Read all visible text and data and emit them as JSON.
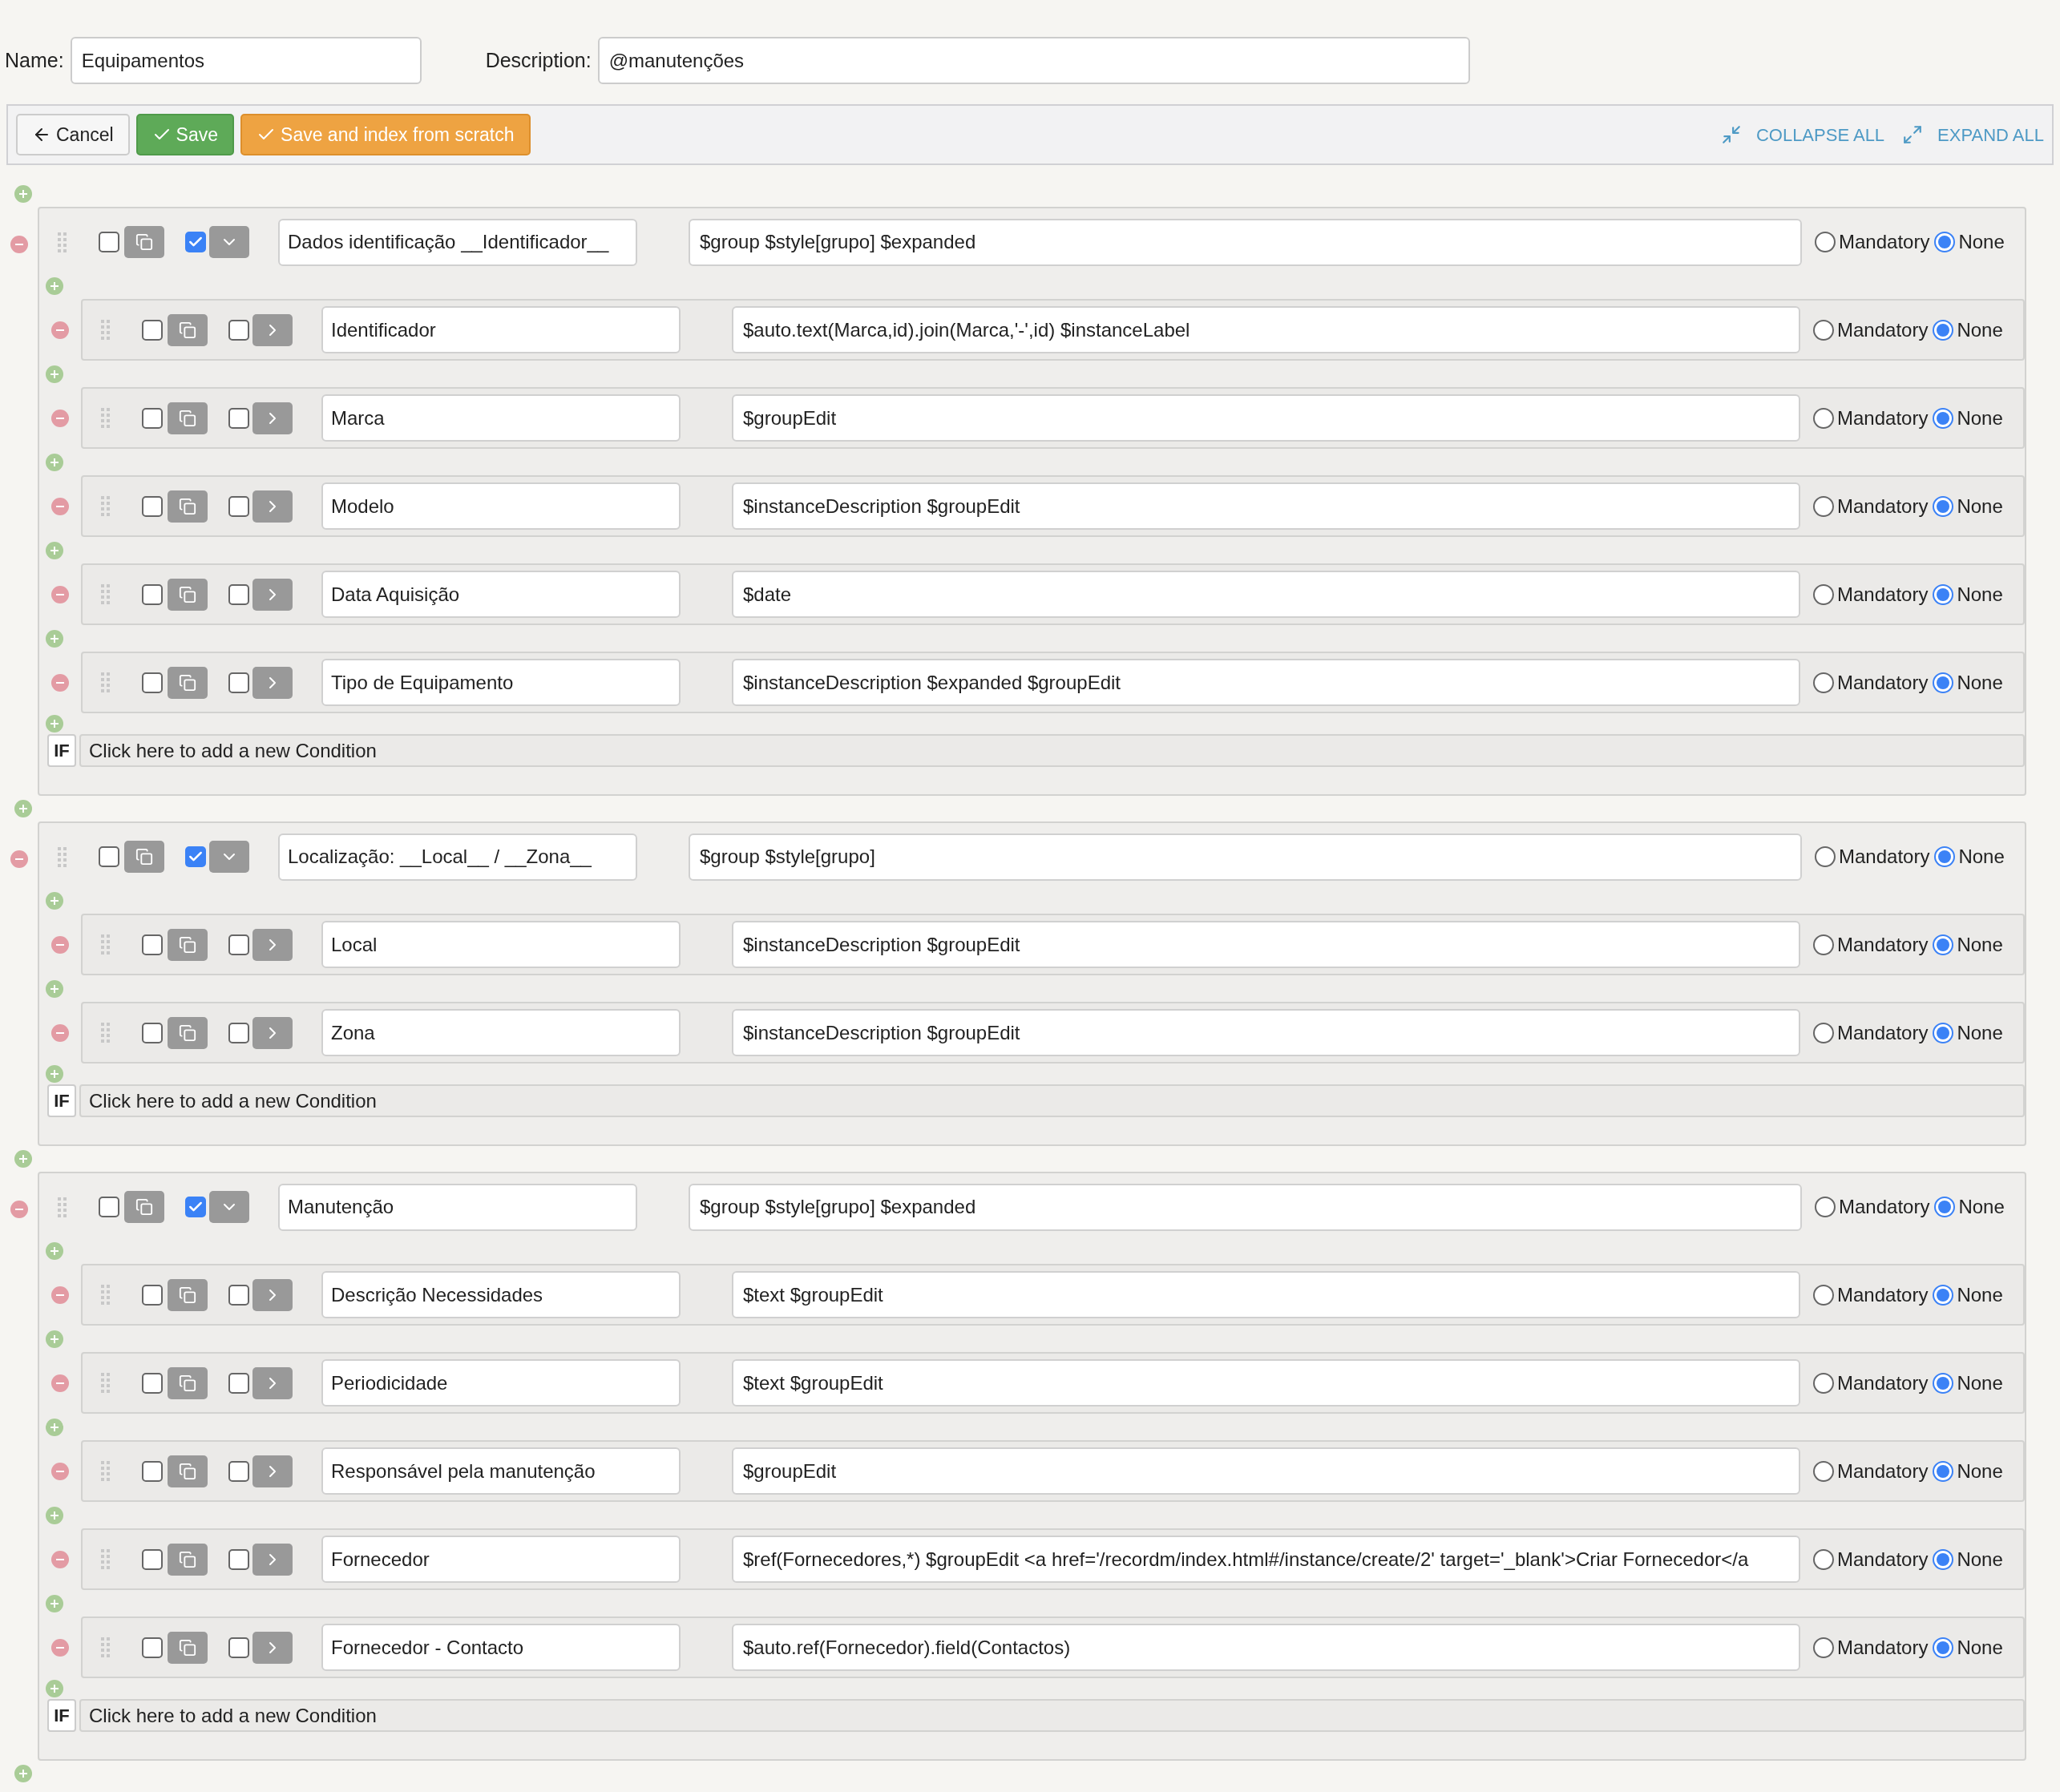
{
  "form": {
    "name_label": "Name:",
    "name_value": "Equipamentos",
    "description_label": "Description:",
    "description_value": "@manutenções"
  },
  "toolbar": {
    "cancel": "Cancel",
    "save": "Save",
    "save_index": "Save and index from scratch",
    "collapse_all": "COLLAPSE ALL",
    "expand_all": "EXPAND ALL"
  },
  "groups": [
    {
      "selected": false,
      "checked": true,
      "expanded": true,
      "name": "Dados identificação __Identificador__",
      "description": "$group $style[grupo] $expanded",
      "options": [
        {
          "label": "Mandatory",
          "selected": false
        },
        {
          "label": "None",
          "selected": true
        }
      ],
      "children": [
        {
          "selected": false,
          "checked": false,
          "expanded": false,
          "name": "Identificador",
          "description": "$auto.text(Marca,id).join(Marca,'-',id) $instanceLabel",
          "options": [
            {
              "label": "Mandatory",
              "selected": false
            },
            {
              "label": "None",
              "selected": true
            }
          ]
        },
        {
          "selected": false,
          "checked": false,
          "expanded": false,
          "name": "Marca",
          "description": "$groupEdit",
          "options": [
            {
              "label": "Mandatory",
              "selected": false
            },
            {
              "label": "None",
              "selected": true
            }
          ]
        },
        {
          "selected": false,
          "checked": false,
          "expanded": false,
          "name": "Modelo",
          "description": "$instanceDescription $groupEdit",
          "options": [
            {
              "label": "Mandatory",
              "selected": false
            },
            {
              "label": "None",
              "selected": true
            }
          ]
        },
        {
          "selected": false,
          "checked": false,
          "expanded": false,
          "name": "Data Aquisição",
          "description": "$date",
          "options": [
            {
              "label": "Mandatory",
              "selected": false
            },
            {
              "label": "None",
              "selected": true
            }
          ]
        },
        {
          "selected": false,
          "checked": false,
          "expanded": false,
          "name": "Tipo de Equipamento",
          "description": "$instanceDescription $expanded $groupEdit",
          "options": [
            {
              "label": "Mandatory",
              "selected": false
            },
            {
              "label": "None",
              "selected": true
            }
          ]
        }
      ],
      "condition": {
        "badge": "IF",
        "text": "Click here to add a new Condition"
      }
    },
    {
      "selected": false,
      "checked": true,
      "expanded": true,
      "name": "Localização: __Local__ / __Zona__",
      "description": "$group $style[grupo]",
      "options": [
        {
          "label": "Mandatory",
          "selected": false
        },
        {
          "label": "None",
          "selected": true
        }
      ],
      "children": [
        {
          "selected": false,
          "checked": false,
          "expanded": false,
          "name": "Local",
          "description": "$instanceDescription $groupEdit",
          "options": [
            {
              "label": "Mandatory",
              "selected": false
            },
            {
              "label": "None",
              "selected": true
            }
          ]
        },
        {
          "selected": false,
          "checked": false,
          "expanded": false,
          "name": "Zona",
          "description": "$instanceDescription $groupEdit",
          "options": [
            {
              "label": "Mandatory",
              "selected": false
            },
            {
              "label": "None",
              "selected": true
            }
          ]
        }
      ],
      "condition": {
        "badge": "IF",
        "text": "Click here to add a new Condition"
      }
    },
    {
      "selected": false,
      "checked": true,
      "expanded": true,
      "name": "Manutenção",
      "description": "$group $style[grupo] $expanded",
      "options": [
        {
          "label": "Mandatory",
          "selected": false
        },
        {
          "label": "None",
          "selected": true
        }
      ],
      "children": [
        {
          "selected": false,
          "checked": false,
          "expanded": false,
          "name": "Descrição Necessidades",
          "description": "$text $groupEdit",
          "options": [
            {
              "label": "Mandatory",
              "selected": false
            },
            {
              "label": "None",
              "selected": true
            }
          ]
        },
        {
          "selected": false,
          "checked": false,
          "expanded": false,
          "name": "Periodicidade",
          "description": "$text $groupEdit",
          "options": [
            {
              "label": "Mandatory",
              "selected": false
            },
            {
              "label": "None",
              "selected": true
            }
          ]
        },
        {
          "selected": false,
          "checked": false,
          "expanded": false,
          "name": "Responsável pela manutenção",
          "description": "$groupEdit",
          "options": [
            {
              "label": "Mandatory",
              "selected": false
            },
            {
              "label": "None",
              "selected": true
            }
          ]
        },
        {
          "selected": false,
          "checked": false,
          "expanded": false,
          "name": "Fornecedor",
          "description": "$ref(Fornecedores,*) $groupEdit <a href='/recordm/index.html#/instance/create/2' target='_blank'>Criar Fornecedor</a",
          "options": [
            {
              "label": "Mandatory",
              "selected": false
            },
            {
              "label": "None",
              "selected": true
            }
          ]
        },
        {
          "selected": false,
          "checked": false,
          "expanded": false,
          "name": "Fornecedor - Contacto",
          "description": "$auto.ref(Fornecedor).field(Contactos)",
          "options": [
            {
              "label": "Mandatory",
              "selected": false
            },
            {
              "label": "None",
              "selected": true
            }
          ]
        }
      ],
      "condition": {
        "badge": "IF",
        "text": "Click here to add a new Condition"
      }
    }
  ]
}
